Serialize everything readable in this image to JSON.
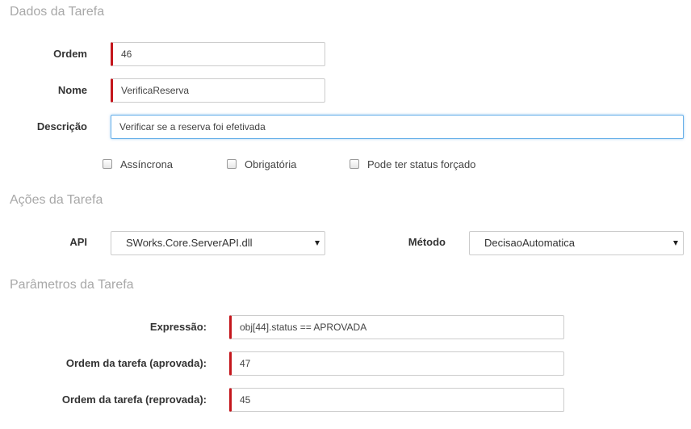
{
  "dados": {
    "title": "Dados da Tarefa",
    "ordem": {
      "label": "Ordem",
      "value": "46"
    },
    "nome": {
      "label": "Nome",
      "value": "VerificaReserva"
    },
    "descricao": {
      "label": "Descrição",
      "value": "Verificar se a reserva foi efetivada"
    },
    "checkboxes": [
      {
        "label": "Assíncrona",
        "checked": false
      },
      {
        "label": "Obrigatória",
        "checked": false
      },
      {
        "label": "Pode ter status forçado",
        "checked": false
      }
    ]
  },
  "acoes": {
    "title": "Ações da Tarefa",
    "api": {
      "label": "API",
      "value": "SWorks.Core.ServerAPI.dll"
    },
    "metodo": {
      "label": "Método",
      "value": "DecisaoAutomatica"
    }
  },
  "parametros": {
    "title": "Parâmetros da Tarefa",
    "expressao": {
      "label": "Expressão:",
      "value": "obj[44].status == APROVADA"
    },
    "aprovada": {
      "label": "Ordem da tarefa (aprovada):",
      "value": "47"
    },
    "reprovada": {
      "label": "Ordem da tarefa (reprovada):",
      "value": "45"
    }
  },
  "colors": {
    "required_marker": "#c4161c",
    "focus_border": "#66afe9",
    "section_title": "#a8a8a8"
  }
}
